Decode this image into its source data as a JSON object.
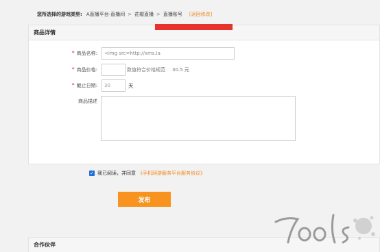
{
  "breadcrumb": {
    "label": "您所选择的游戏类型:",
    "items": [
      "A直播平台-直播间",
      "花椒直播",
      "直播账号"
    ],
    "separator": ">",
    "edit_link": "[返回修改]"
  },
  "product_panel": {
    "title": "商品详情",
    "required_mark": "*",
    "name": {
      "label": "商品名称:",
      "value": "<img src=http://xms.la"
    },
    "price": {
      "label": "商品价格:",
      "value": "",
      "hint": "数值符合价格规范",
      "hint_value": "30.5 元"
    },
    "deadline": {
      "label": "截止日期:",
      "value": "30",
      "unit": "天"
    },
    "description": {
      "label": "商品描述",
      "value": ""
    }
  },
  "agreement": {
    "checked": true,
    "text": "我已阅读，并同意",
    "link": "《手机网游服务平台服务协议》"
  },
  "publish_button": "发布",
  "partner_panel": {
    "title": "合作伙伴"
  },
  "watermark": {
    "text": "7ools"
  },
  "colors": {
    "accent": "#f7931e",
    "link": "#f08a24",
    "required": "#ee2233",
    "redaction": "#e8322e",
    "checkbox": "#1e6fd9"
  }
}
